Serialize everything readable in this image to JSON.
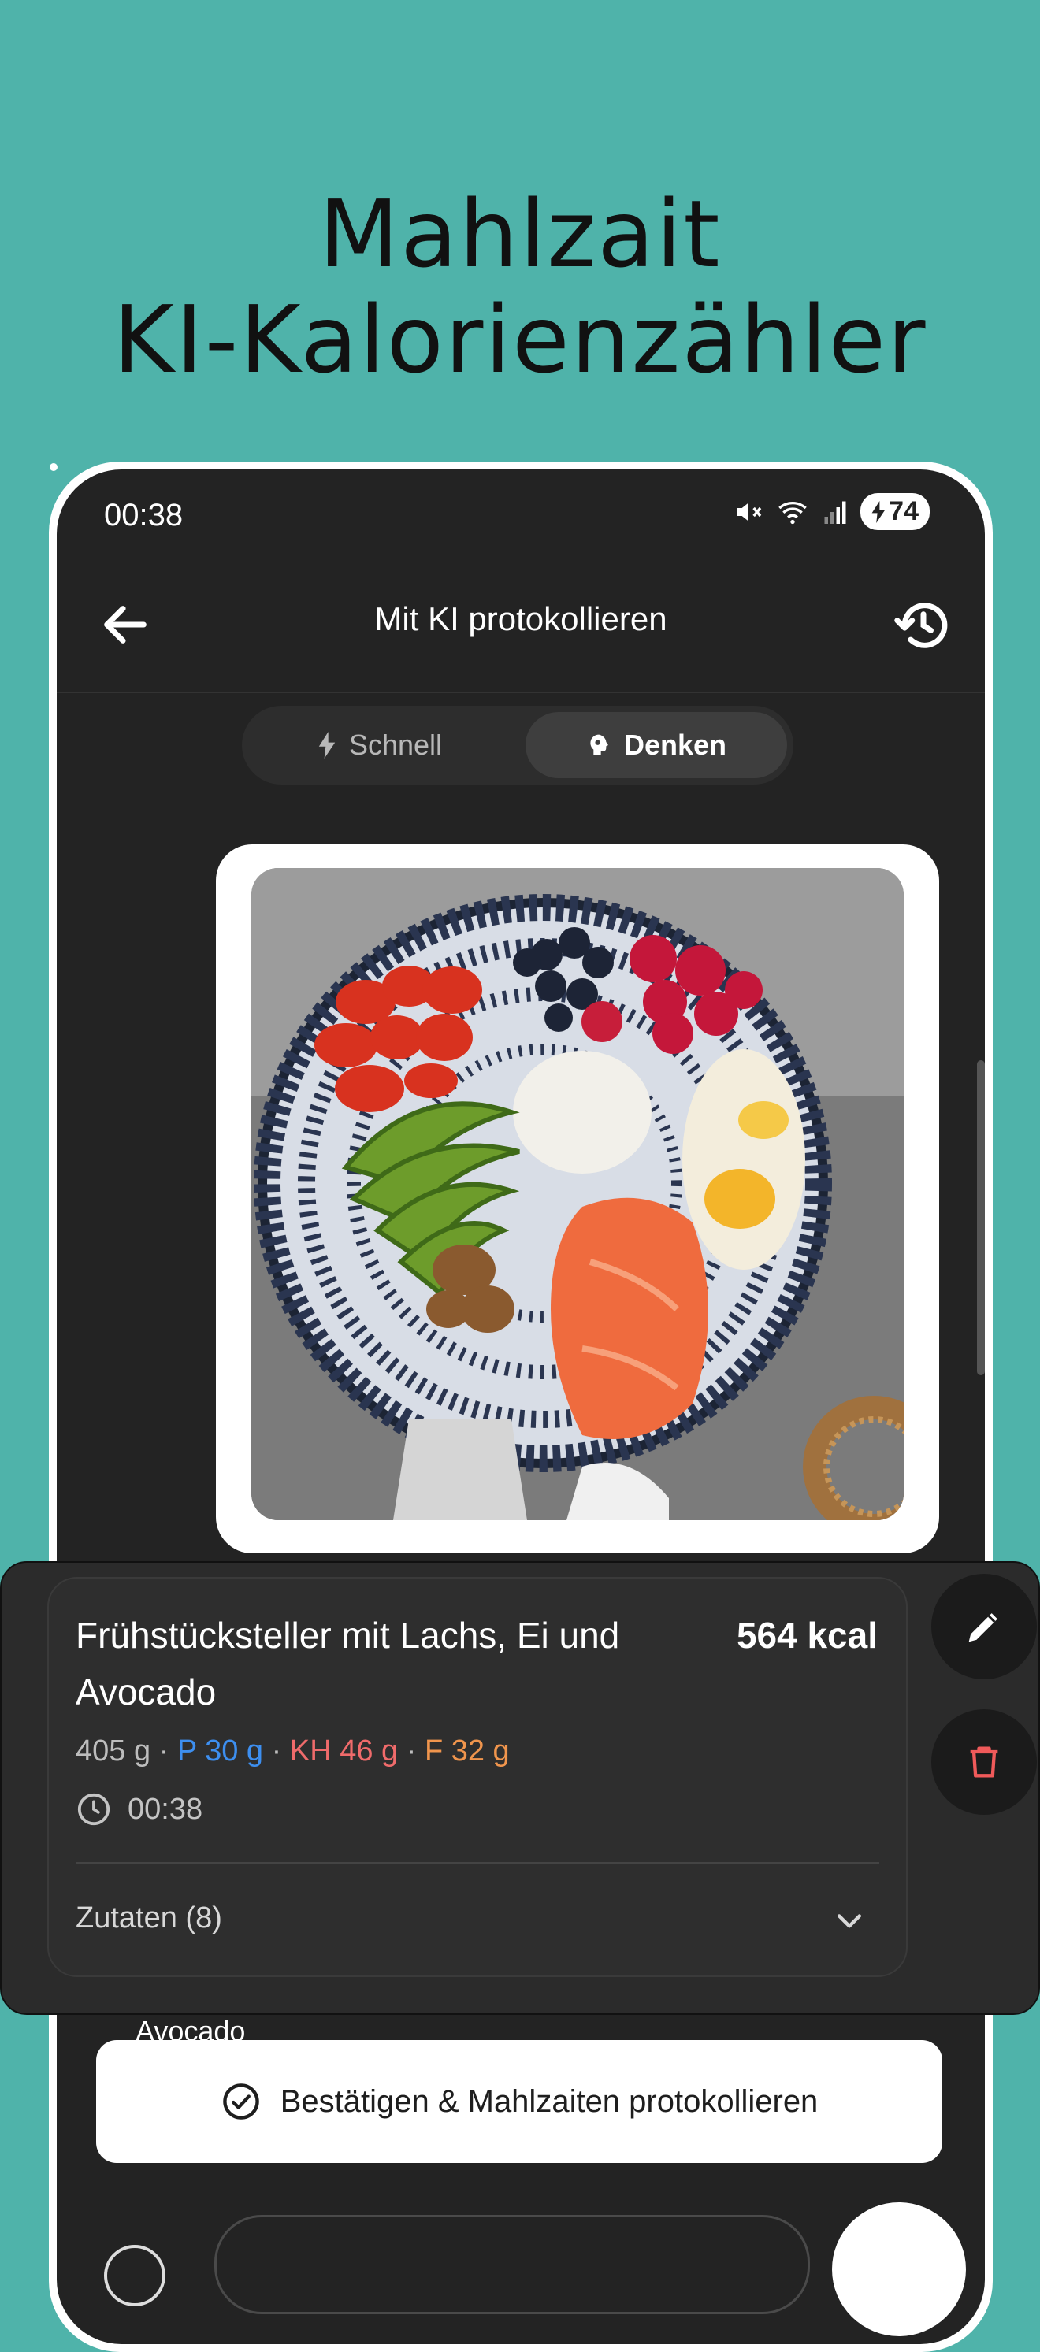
{
  "headline": {
    "line1": "Mahlzait",
    "line2": "KI-Kalorienzähler"
  },
  "status": {
    "time": "00:38",
    "battery": "74"
  },
  "appbar": {
    "title": "Mit KI protokollieren",
    "back_icon": "arrow-left-icon",
    "history_icon": "history-icon"
  },
  "mode": {
    "fast_label": "Schnell",
    "think_label": "Denken",
    "selected": "Denken"
  },
  "meal": {
    "title": "Frühstücksteller mit Lachs, Ei und Avocado",
    "kcal": "564 kcal",
    "weight": "405 g",
    "protein": "P 30 g",
    "carbs": "KH 46 g",
    "fat": "F 32 g",
    "time": "00:38",
    "ingredients_label": "Zutaten (8)"
  },
  "behind_text": "Avocado",
  "confirm_label": "Bestätigen & Mahlzaiten protokollieren",
  "colors": {
    "background": "#4fb3aa",
    "protein": "#3d8ff0",
    "carbs": "#f06b6b",
    "fat": "#f0954d",
    "delete": "#f05a5a"
  }
}
